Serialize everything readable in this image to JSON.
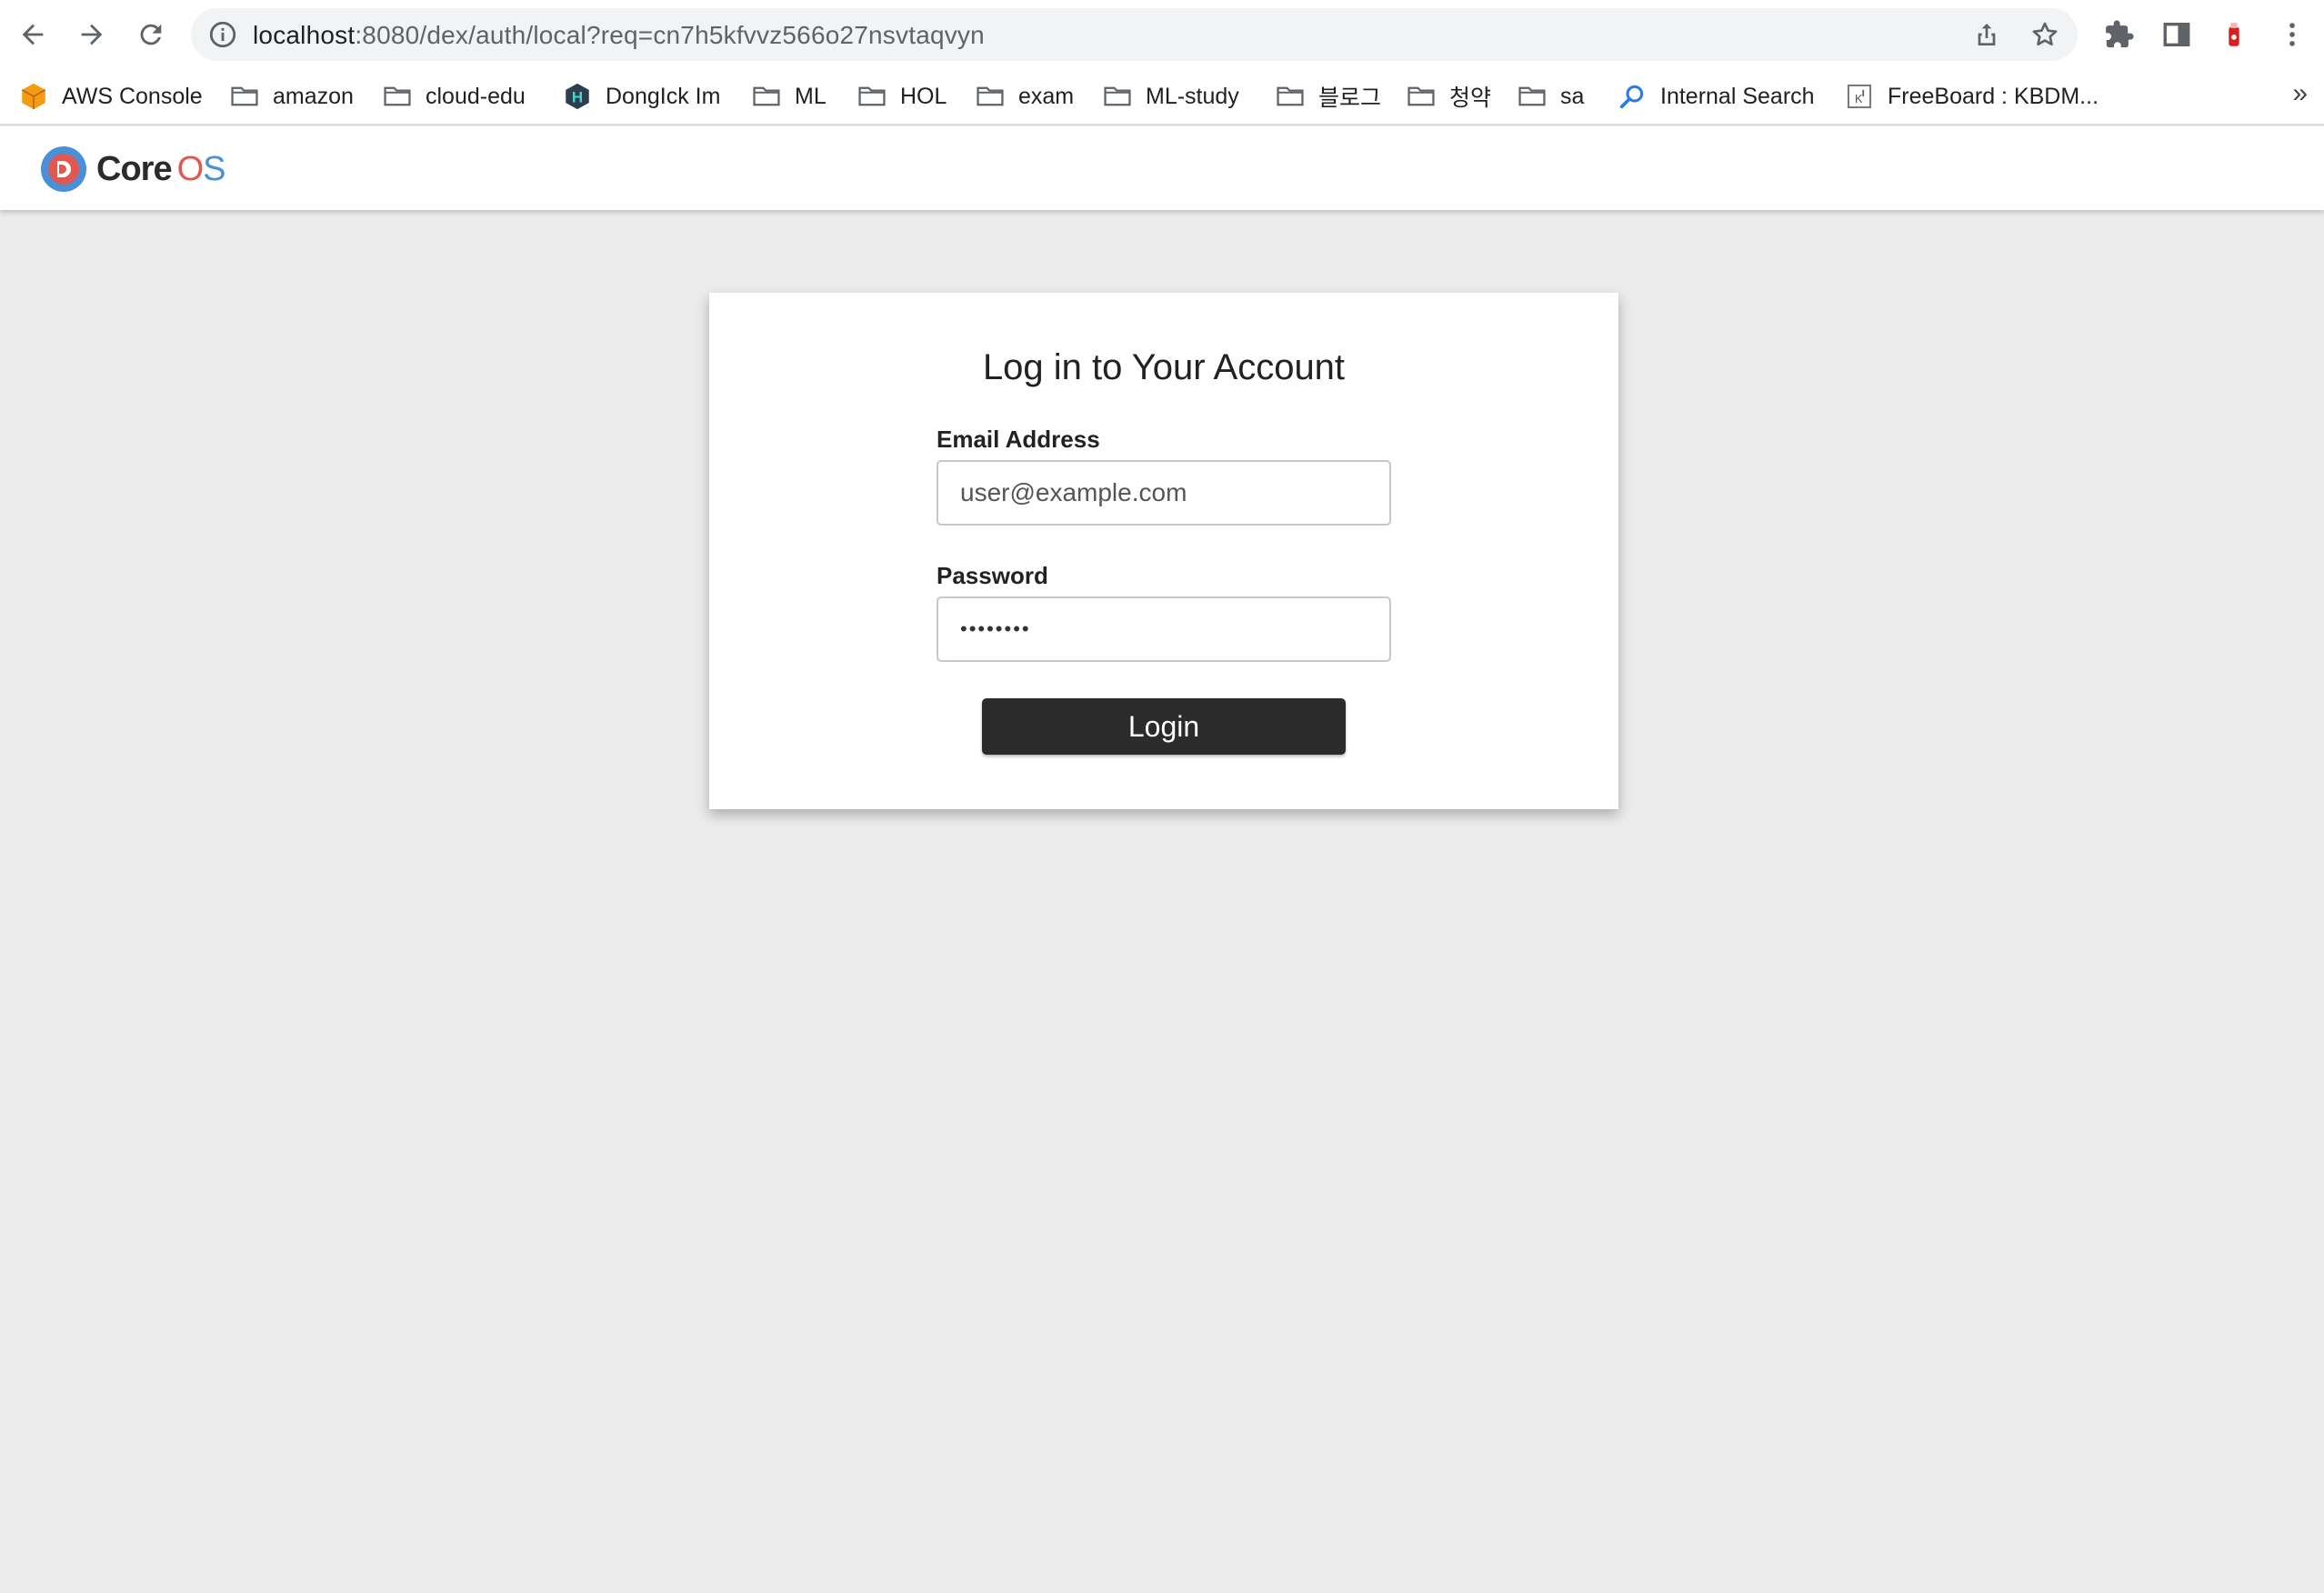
{
  "browser": {
    "url_host": "localhost",
    "url_rest": ":8080/dex/auth/local?req=cn7h5kfvvz566o27nsvtaqvyn",
    "bookmarks": [
      {
        "label": "AWS Console",
        "icon": "aws-cube-icon"
      },
      {
        "label": "amazon",
        "icon": "folder-icon"
      },
      {
        "label": "cloud-edu",
        "icon": "folder-icon"
      },
      {
        "label": "DongIck Im",
        "icon": "hexagon-h-icon"
      },
      {
        "label": "ML",
        "icon": "folder-icon"
      },
      {
        "label": "HOL",
        "icon": "folder-icon"
      },
      {
        "label": "exam",
        "icon": "folder-icon"
      },
      {
        "label": "ML-study",
        "icon": "folder-icon"
      },
      {
        "label": "블로그",
        "icon": "folder-icon"
      },
      {
        "label": "청약",
        "icon": "folder-icon"
      },
      {
        "label": "sa",
        "icon": "folder-icon"
      },
      {
        "label": "Internal Search",
        "icon": "search-icon"
      },
      {
        "label": "FreeBoard : KBDM...",
        "icon": "page-icon"
      }
    ],
    "bookmarks_overflow": "»"
  },
  "app": {
    "logo_core": "Core",
    "logo_os_o": "O",
    "logo_os_s": "S"
  },
  "login": {
    "title": "Log in to Your Account",
    "email_label": "Email Address",
    "email_placeholder": "user@example.com",
    "password_label": "Password",
    "password_value": "••••••••",
    "submit_label": "Login"
  },
  "colors": {
    "page_bg": "#ececec",
    "button_bg": "#2b2b2b",
    "logo_blue": "#4a90d9",
    "logo_red": "#e0584f"
  }
}
